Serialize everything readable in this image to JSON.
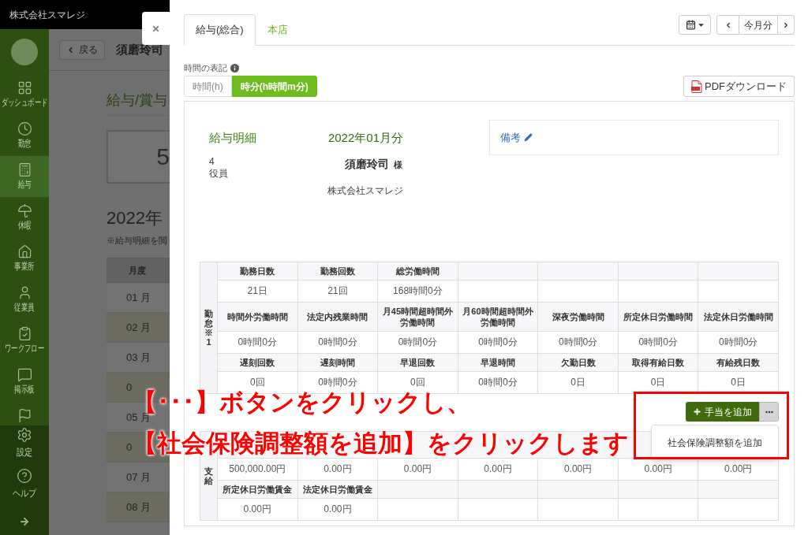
{
  "page": {
    "company": "株式会社スマレジ",
    "sidebar": {
      "items": [
        {
          "label": "ダッシュボード",
          "selected": false
        },
        {
          "label": "勤怠",
          "selected": false
        },
        {
          "label": "給与",
          "selected": true
        },
        {
          "label": "休暇",
          "selected": false
        },
        {
          "label": "事業所",
          "selected": false
        },
        {
          "label": "従業員",
          "selected": false
        },
        {
          "label": "ワークフロー",
          "selected": false
        },
        {
          "label": "掲示板",
          "selected": false
        },
        {
          "selected": false
        }
      ],
      "footer_items": [
        {
          "label": "設定"
        },
        {
          "label": "ヘルプ"
        }
      ]
    },
    "header": {
      "back_button": "戻る",
      "employee_name": "須磨玲司"
    },
    "section_title": "給与/賞与",
    "summary_value": "5",
    "year_title": "2022年",
    "note": "※給与明細を閲",
    "table": {
      "columns": [
        "月度"
      ],
      "rows": [
        [
          "01 月"
        ],
        [
          "02 月"
        ],
        [
          "03 月"
        ],
        [
          "0"
        ],
        [
          "05 月"
        ],
        [
          "0"
        ],
        [
          "07 月"
        ],
        [
          "08 月"
        ]
      ]
    }
  },
  "modal": {
    "tabs": [
      {
        "label": "給与(総合)",
        "selected": true
      },
      {
        "label": "本店",
        "selected": false
      }
    ],
    "period": {
      "label": "今月分"
    },
    "time_format": {
      "label": "時間の表記",
      "options": [
        {
          "label": "時間(h)",
          "selected": false
        },
        {
          "label": "時分(h時間m分)",
          "selected": true
        }
      ]
    },
    "pdf_button": "PDFダウンロード",
    "slip": {
      "title": "給与明細",
      "period": "2022年01月分",
      "employee_number": "4",
      "position": "役員",
      "employee_name": "須磨玲司",
      "honorific": "様",
      "company": "株式会社スマレジ",
      "remarks_label": "備考"
    },
    "attendance": {
      "side_label": "勤怠※1",
      "rows": [
        {
          "kind": "header",
          "cells": [
            "勤務日数",
            "勤務回数",
            "総労働時間"
          ]
        },
        {
          "kind": "value",
          "cells": [
            "21日",
            "21回",
            "168時間0分"
          ]
        },
        {
          "kind": "header",
          "cells": [
            "時間外労働時間",
            "法定内残業時間",
            "月45時間超時間外労働時間",
            "月60時間超時間外労働時間",
            "深夜労働時間",
            "所定休日労働時間",
            "法定休日労働時間"
          ]
        },
        {
          "kind": "value",
          "cells": [
            "0時間0分",
            "0時間0分",
            "0時間0分",
            "0時間0分",
            "0時間0分",
            "0時間0分",
            "0時間0分"
          ]
        },
        {
          "kind": "header",
          "cells": [
            "遅刻回数",
            "遅刻時間",
            "早退回数",
            "早退時間",
            "欠勤日数",
            "取得有給日数",
            "有給残日数"
          ]
        },
        {
          "kind": "value",
          "cells": [
            "0回",
            "0時間0分",
            "0回",
            "0時間0分",
            "0日",
            "0日",
            "0日"
          ]
        }
      ]
    },
    "actions": {
      "add_button": "手当を追加",
      "more_expanded": true,
      "menu_items": [
        "社会保険調整額を追加"
      ]
    },
    "payment": {
      "side_label": "支給",
      "rows": [
        {
          "kind": "header"
        },
        {
          "kind": "value",
          "cells": [
            "500,000.00円",
            "0.00円",
            "0.00円",
            "0.00円",
            "0.00円",
            "0.00円",
            "0.00円"
          ]
        },
        {
          "kind": "header",
          "cells": [
            "所定休日労働賃金",
            "法定休日労働賃金"
          ]
        },
        {
          "kind": "value",
          "cells": [
            "0.00円",
            "0.00円"
          ]
        }
      ]
    }
  },
  "annotation": {
    "lines": [
      "【･･･】ボタンをクリックし、",
      "【社会保険調整額を追加】をクリックします"
    ]
  }
}
